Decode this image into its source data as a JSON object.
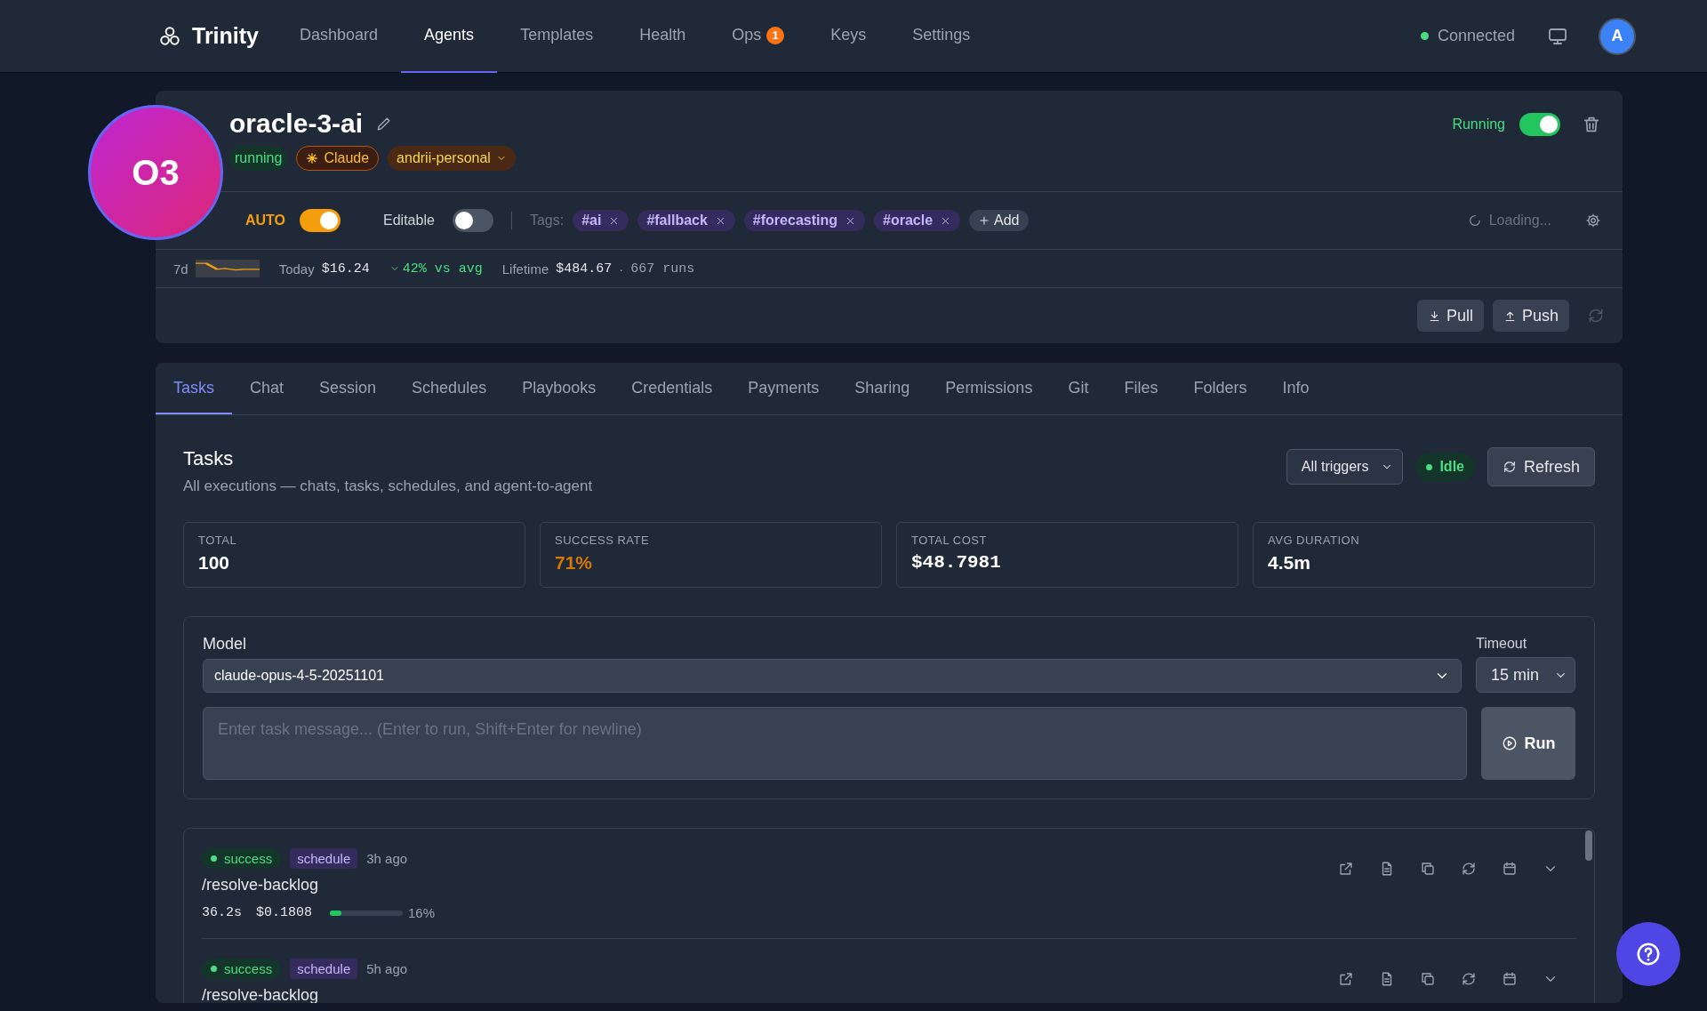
{
  "nav": {
    "brand": "Trinity",
    "items": [
      {
        "label": "Dashboard",
        "selected": false
      },
      {
        "label": "Agents",
        "selected": true
      },
      {
        "label": "Templates",
        "selected": false
      },
      {
        "label": "Health",
        "selected": false
      },
      {
        "label": "Ops",
        "selected": false,
        "badge": "1"
      },
      {
        "label": "Keys",
        "selected": false
      },
      {
        "label": "Settings",
        "selected": false
      }
    ],
    "connection": {
      "label": "Connected",
      "connected": true
    },
    "avatar": "A"
  },
  "agent": {
    "avatar": "O3",
    "name": "oracle-3-ai",
    "badges": [
      {
        "kind": "status",
        "label": "running"
      },
      {
        "kind": "runtime",
        "label": "Claude"
      },
      {
        "kind": "owner",
        "label": "andrii-personal"
      }
    ],
    "running": {
      "label": "Running",
      "on": true
    },
    "auto": {
      "label": "AUTO",
      "on": true
    },
    "editable": {
      "label": "Editable",
      "on": false
    },
    "tags_label": "Tags:",
    "tags": [
      "#ai",
      "#fallback",
      "#forecasting",
      "#oracle"
    ],
    "add_tag": "Add",
    "loading": "Loading...",
    "usage": {
      "range": "7d",
      "today_label": "Today",
      "today": "$16.24",
      "trend": "42% vs avg",
      "lifetime_label": "Lifetime",
      "lifetime": "$484.67",
      "separator": "·",
      "runs": "667 runs"
    },
    "actions": [
      "Pull",
      "Push"
    ]
  },
  "tabs": [
    {
      "label": "Tasks",
      "selected": true
    },
    {
      "label": "Chat",
      "selected": false
    },
    {
      "label": "Session",
      "selected": false
    },
    {
      "label": "Schedules",
      "selected": false
    },
    {
      "label": "Playbooks",
      "selected": false
    },
    {
      "label": "Credentials",
      "selected": false
    },
    {
      "label": "Payments",
      "selected": false
    },
    {
      "label": "Sharing",
      "selected": false
    },
    {
      "label": "Permissions",
      "selected": false
    },
    {
      "label": "Git",
      "selected": false
    },
    {
      "label": "Files",
      "selected": false
    },
    {
      "label": "Folders",
      "selected": false
    },
    {
      "label": "Info",
      "selected": false
    }
  ],
  "tasks": {
    "title": "Tasks",
    "subtitle": "All executions — chats, tasks, schedules, and agent-to-agent",
    "filter": "All triggers",
    "state": "Idle",
    "refresh": "Refresh",
    "stats": [
      {
        "label": "TOTAL",
        "value": "100",
        "kind": "plain"
      },
      {
        "label": "SUCCESS RATE",
        "value": "71%",
        "kind": "rate"
      },
      {
        "label": "TOTAL COST",
        "value": "$48.7981",
        "kind": "money"
      },
      {
        "label": "AVG DURATION",
        "value": "4.5m",
        "kind": "plain"
      }
    ]
  },
  "runner": {
    "model_label": "Model",
    "model": "claude-opus-4-5-20251101",
    "timeout_label": "Timeout",
    "timeout": "15 min",
    "placeholder": "Enter task message... (Enter to run, Shift+Enter for newline)",
    "run": "Run"
  },
  "executions": [
    {
      "status": "success",
      "trigger": "schedule",
      "time": "3h ago",
      "name": "/resolve-backlog",
      "duration": "36.2s",
      "cost": "$0.1808",
      "level": 0.16,
      "percent": "16%"
    },
    {
      "status": "success",
      "trigger": "schedule",
      "time": "5h ago",
      "name": "/resolve-backlog"
    }
  ]
}
